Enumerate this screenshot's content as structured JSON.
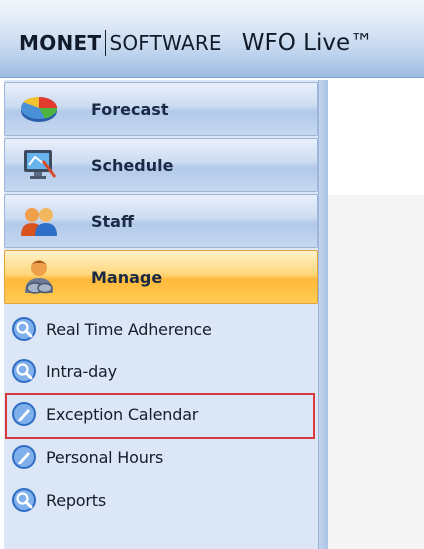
{
  "header": {
    "brand_bold": "MONET",
    "brand_light": "SOFTWARE",
    "product": "WFO Live™"
  },
  "sidebar": {
    "nav": [
      {
        "label": "Forecast",
        "icon": "forecast-pie-icon",
        "active": false
      },
      {
        "label": "Schedule",
        "icon": "schedule-monitor-icon",
        "active": false
      },
      {
        "label": "Staff",
        "icon": "staff-people-icon",
        "active": false
      },
      {
        "label": "Manage",
        "icon": "manage-person-icon",
        "active": true
      }
    ],
    "items": [
      {
        "label": "Real Time Adherence",
        "icon": "magnifier-icon"
      },
      {
        "label": "Intra-day",
        "icon": "magnifier-icon"
      },
      {
        "label": "Exception Calendar",
        "icon": "pencil-icon",
        "highlighted": true
      },
      {
        "label": "Personal Hours",
        "icon": "pencil-icon"
      },
      {
        "label": "Reports",
        "icon": "magnifier-icon"
      }
    ]
  },
  "colors": {
    "highlight_border": "#d9383d",
    "active_nav": "#ffb93a",
    "sidebar_bg": "#dbe6f6"
  }
}
